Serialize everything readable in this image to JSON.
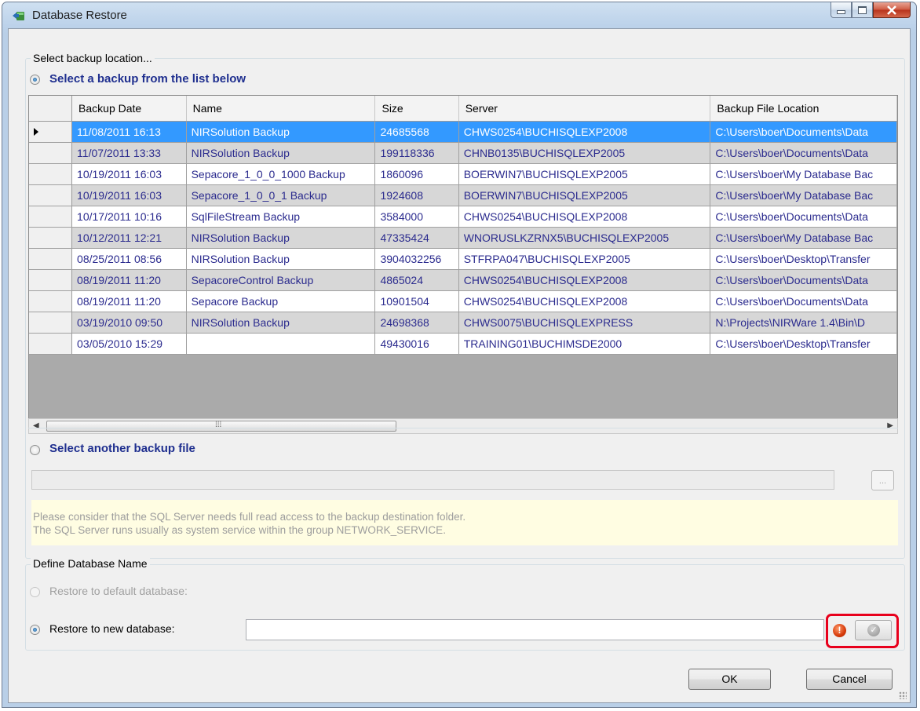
{
  "window": {
    "title": "Database Restore"
  },
  "backup_group": {
    "label": "Select backup location...",
    "option_list": "Select a backup from the list below",
    "option_file": "Select another backup file",
    "browse_label": "...",
    "notice_line1": "Please consider that the SQL Server needs full read access to the backup destination folder.",
    "notice_line2": "The SQL Server runs usually as system service within the group NETWORK_SERVICE."
  },
  "table": {
    "columns": [
      "Backup Date",
      "Name",
      "Size",
      "Server",
      "Backup File Location"
    ],
    "rows": [
      {
        "date": "11/08/2011 16:13",
        "name": "NIRSolution Backup",
        "size": "24685568",
        "server": "CHWS0254\\BUCHISQLEXP2008",
        "location": "C:\\Users\\boer\\Documents\\Data"
      },
      {
        "date": "11/07/2011 13:33",
        "name": "NIRSolution Backup",
        "size": "199118336",
        "server": "CHNB0135\\BUCHISQLEXP2005",
        "location": "C:\\Users\\boer\\Documents\\Data"
      },
      {
        "date": "10/19/2011 16:03",
        "name": "Sepacore_1_0_0_1000 Backup",
        "size": "1860096",
        "server": "BOERWIN7\\BUCHISQLEXP2005",
        "location": "C:\\Users\\boer\\My Database Bac"
      },
      {
        "date": "10/19/2011 16:03",
        "name": "Sepacore_1_0_0_1 Backup",
        "size": "1924608",
        "server": "BOERWIN7\\BUCHISQLEXP2005",
        "location": "C:\\Users\\boer\\My Database Bac"
      },
      {
        "date": "10/17/2011 10:16",
        "name": "SqlFileStream Backup",
        "size": "3584000",
        "server": "CHWS0254\\BUCHISQLEXP2008",
        "location": "C:\\Users\\boer\\Documents\\Data"
      },
      {
        "date": "10/12/2011 12:21",
        "name": "NIRSolution Backup",
        "size": "47335424",
        "server": "WNORUSLKZRNX5\\BUCHISQLEXP2005",
        "location": "C:\\Users\\boer\\My Database Bac"
      },
      {
        "date": "08/25/2011 08:56",
        "name": "NIRSolution Backup",
        "size": "3904032256",
        "server": "STFRPA047\\BUCHISQLEXP2005",
        "location": "C:\\Users\\boer\\Desktop\\Transfer"
      },
      {
        "date": "08/19/2011 11:20",
        "name": "SepacoreControl Backup",
        "size": "4865024",
        "server": "CHWS0254\\BUCHISQLEXP2008",
        "location": "C:\\Users\\boer\\Documents\\Data"
      },
      {
        "date": "08/19/2011 11:20",
        "name": "Sepacore Backup",
        "size": "10901504",
        "server": "CHWS0254\\BUCHISQLEXP2008",
        "location": "C:\\Users\\boer\\Documents\\Data"
      },
      {
        "date": "03/19/2010 09:50",
        "name": "NIRSolution Backup",
        "size": "24698368",
        "server": "CHWS0075\\BUCHISQLEXPRESS",
        "location": "N:\\Projects\\NIRWare 1.4\\Bin\\D"
      },
      {
        "date": "03/05/2010 15:29",
        "name": "",
        "size": "49430016",
        "server": "TRAINING01\\BUCHIMSDE2000",
        "location": "C:\\Users\\boer\\Desktop\\Transfer"
      }
    ],
    "selected_row": 0
  },
  "name_group": {
    "label": "Define Database Name",
    "option_default": "Restore to default database:",
    "option_new": "Restore to new database:",
    "new_name_value": ""
  },
  "buttons": {
    "ok": "OK",
    "cancel": "Cancel"
  },
  "icons": {
    "title": "database-restore-icon",
    "error": "error-icon",
    "validate": "check-icon"
  },
  "colors": {
    "selection": "#3399ff",
    "row_text": "#2b2b8e",
    "highlight_border": "#e8001c",
    "notice_bg": "#fffde2"
  }
}
